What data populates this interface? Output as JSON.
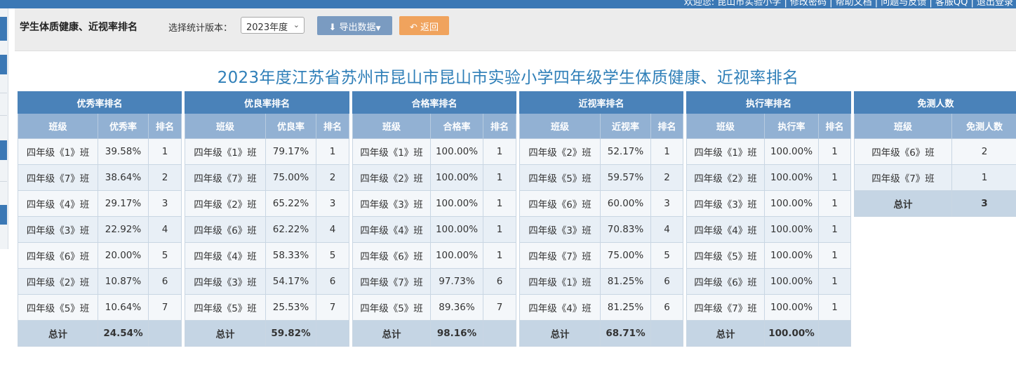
{
  "topbar": {
    "user_text": "欢迎您: 昆山市实验小学 | 修改密码 | 帮助文档 | 问题与反馈 | 客服QQ | 退出登录"
  },
  "toolbar": {
    "title": "学生体质健康、近视率排名",
    "version_label": "选择统计版本：",
    "version_value": "2023年度",
    "export_label": "导出数据",
    "back_label": "返回"
  },
  "report_title": "2023年度江苏省苏州市昆山市昆山市实验小学四年级学生体质健康、近视率排名",
  "tables": [
    {
      "caption": "优秀率排名",
      "headers": [
        "班级",
        "优秀率",
        "排名"
      ],
      "rows": [
        [
          "四年级《1》班",
          "39.58%",
          "1"
        ],
        [
          "四年级《7》班",
          "38.64%",
          "2"
        ],
        [
          "四年级《4》班",
          "29.17%",
          "3"
        ],
        [
          "四年级《3》班",
          "22.92%",
          "4"
        ],
        [
          "四年级《6》班",
          "20.00%",
          "5"
        ],
        [
          "四年级《2》班",
          "10.87%",
          "6"
        ],
        [
          "四年级《5》班",
          "10.64%",
          "7"
        ]
      ],
      "total": [
        "总计",
        "24.54%",
        ""
      ]
    },
    {
      "caption": "优良率排名",
      "headers": [
        "班级",
        "优良率",
        "排名"
      ],
      "rows": [
        [
          "四年级《1》班",
          "79.17%",
          "1"
        ],
        [
          "四年级《7》班",
          "75.00%",
          "2"
        ],
        [
          "四年级《2》班",
          "65.22%",
          "3"
        ],
        [
          "四年级《6》班",
          "62.22%",
          "4"
        ],
        [
          "四年级《4》班",
          "58.33%",
          "5"
        ],
        [
          "四年级《3》班",
          "54.17%",
          "6"
        ],
        [
          "四年级《5》班",
          "25.53%",
          "7"
        ]
      ],
      "total": [
        "总计",
        "59.82%",
        ""
      ]
    },
    {
      "caption": "合格率排名",
      "headers": [
        "班级",
        "合格率",
        "排名"
      ],
      "rows": [
        [
          "四年级《1》班",
          "100.00%",
          "1"
        ],
        [
          "四年级《2》班",
          "100.00%",
          "1"
        ],
        [
          "四年级《3》班",
          "100.00%",
          "1"
        ],
        [
          "四年级《4》班",
          "100.00%",
          "1"
        ],
        [
          "四年级《6》班",
          "100.00%",
          "1"
        ],
        [
          "四年级《7》班",
          "97.73%",
          "6"
        ],
        [
          "四年级《5》班",
          "89.36%",
          "7"
        ]
      ],
      "total": [
        "总计",
        "98.16%",
        ""
      ]
    },
    {
      "caption": "近视率排名",
      "headers": [
        "班级",
        "近视率",
        "排名"
      ],
      "rows": [
        [
          "四年级《2》班",
          "52.17%",
          "1"
        ],
        [
          "四年级《5》班",
          "59.57%",
          "2"
        ],
        [
          "四年级《6》班",
          "60.00%",
          "3"
        ],
        [
          "四年级《3》班",
          "70.83%",
          "4"
        ],
        [
          "四年级《7》班",
          "75.00%",
          "5"
        ],
        [
          "四年级《1》班",
          "81.25%",
          "6"
        ],
        [
          "四年级《4》班",
          "81.25%",
          "6"
        ]
      ],
      "total": [
        "总计",
        "68.71%",
        ""
      ]
    },
    {
      "caption": "执行率排名",
      "headers": [
        "班级",
        "执行率",
        "排名"
      ],
      "rows": [
        [
          "四年级《1》班",
          "100.00%",
          "1"
        ],
        [
          "四年级《2》班",
          "100.00%",
          "1"
        ],
        [
          "四年级《3》班",
          "100.00%",
          "1"
        ],
        [
          "四年级《4》班",
          "100.00%",
          "1"
        ],
        [
          "四年级《5》班",
          "100.00%",
          "1"
        ],
        [
          "四年级《6》班",
          "100.00%",
          "1"
        ],
        [
          "四年级《7》班",
          "100.00%",
          "1"
        ]
      ],
      "total": [
        "总计",
        "100.00%",
        ""
      ]
    },
    {
      "caption": "免测人数",
      "headers": [
        "班级",
        "免测人数"
      ],
      "rows": [
        [
          "四年级《6》班",
          "2"
        ],
        [
          "四年级《7》班",
          "1"
        ]
      ],
      "total": [
        "总计",
        "3"
      ]
    }
  ]
}
